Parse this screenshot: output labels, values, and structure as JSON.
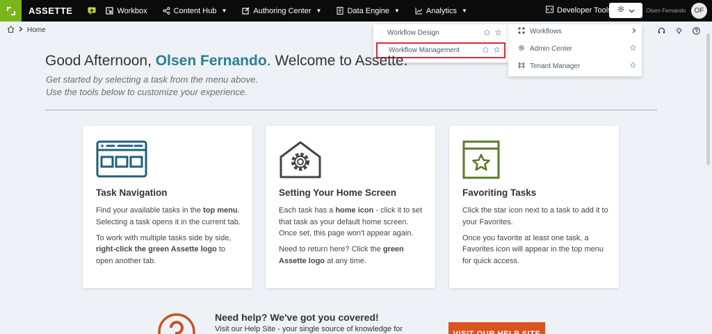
{
  "nav": {
    "brand": "ASSETTE",
    "items": [
      {
        "label": "Workbox",
        "icon": "workbox-icon"
      },
      {
        "label": "Content Hub",
        "icon": "share-icon"
      },
      {
        "label": "Authoring Center",
        "icon": "edit-icon"
      },
      {
        "label": "Data Engine",
        "icon": "document-icon"
      },
      {
        "label": "Analytics",
        "icon": "chart-icon"
      }
    ],
    "developer_tools": "Developer Tools",
    "user_name": "Olsen Fernando",
    "avatar_initials": "OF"
  },
  "breadcrumb": {
    "home": "Home"
  },
  "menu_left": {
    "items": [
      {
        "label": "Workflow Design"
      },
      {
        "label": "Workflow Management",
        "highlighted": true
      }
    ]
  },
  "menu_right": {
    "items": [
      {
        "label": "Workflows",
        "icon": "workflow-icon"
      },
      {
        "label": "Admin Center",
        "icon": "gear-icon"
      },
      {
        "label": "Tenant Manager",
        "icon": "tenant-icon"
      }
    ]
  },
  "welcome": {
    "greeting_pre": "Good Afternoon,",
    "name": "Olsen Fernando",
    "greeting_post": ". Welcome to Assette.",
    "line1": "Get started by selecting a task from the menu above.",
    "line2": "Use the tools below to customize your experience."
  },
  "cards": [
    {
      "title": "Task Navigation",
      "p1": [
        "Find your available tasks in the ",
        "top menu",
        ". Selecting a task opens it in the current tab."
      ],
      "p2": [
        "To work with multiple tasks side by side, ",
        "right-click the green Assette logo",
        " to open another tab."
      ]
    },
    {
      "title": "Setting Your Home Screen",
      "p1": [
        "Each task has a ",
        "home icon",
        " - click it to set that task as your default home screen. Once set, this page won't appear again."
      ],
      "p2": [
        "Need to return here? Click the ",
        "green Assette logo",
        " at any time."
      ]
    },
    {
      "title": "Favoriting Tasks",
      "p1": [
        "Click the star icon next to a task to add it to your Favorites.",
        "",
        ""
      ],
      "p2": [
        "Once you favorite at least one task, a Favorites icon will appear in the top menu for quick access.",
        "",
        ""
      ]
    }
  ],
  "help": {
    "title": "Need help? We've got you covered!",
    "text": "Visit our Help Site - your single source of knowledge for",
    "button": "VISIT OUR HELP SITE"
  },
  "colors": {
    "brand_green": "#7ab51d",
    "accent_teal": "#2a7f8f",
    "help_orange": "#d9541e",
    "highlight_red": "#e0283a"
  }
}
